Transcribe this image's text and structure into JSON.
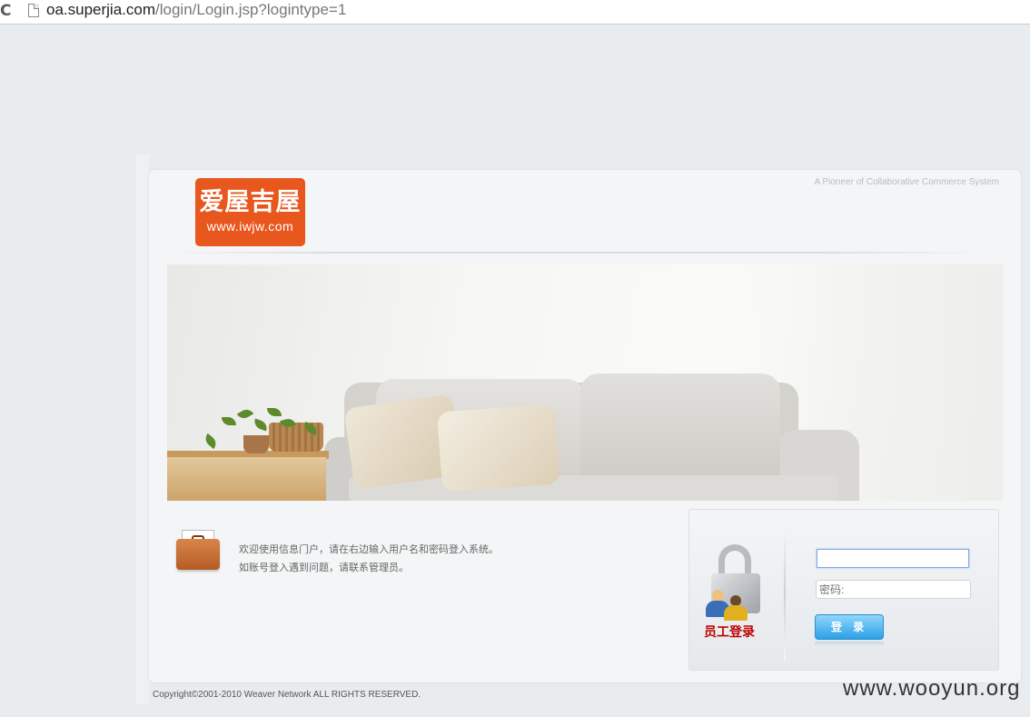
{
  "browser": {
    "url_host": "oa.superjia.com",
    "url_path": "/login/Login.jsp?logintype=1"
  },
  "header": {
    "logo_cn": "爱屋吉屋",
    "logo_url": "www.iwjw.com",
    "tagline": "A Pioneer of Collaborative Commerce System",
    "brand_color": "#e8571d"
  },
  "message": {
    "line1": "欢迎使用信息门户，请在右边输入用户名和密码登入系统。",
    "line2": "如账号登入遇到问题，请联系管理员。"
  },
  "login": {
    "label": "员工登录",
    "username_value": "",
    "password_placeholder": "密码:",
    "button_label": "登 录"
  },
  "footer": {
    "copyright": "Copyright©2001-2010 Weaver Network ALL RIGHTS RESERVED."
  },
  "watermark": "www.wooyun.org"
}
